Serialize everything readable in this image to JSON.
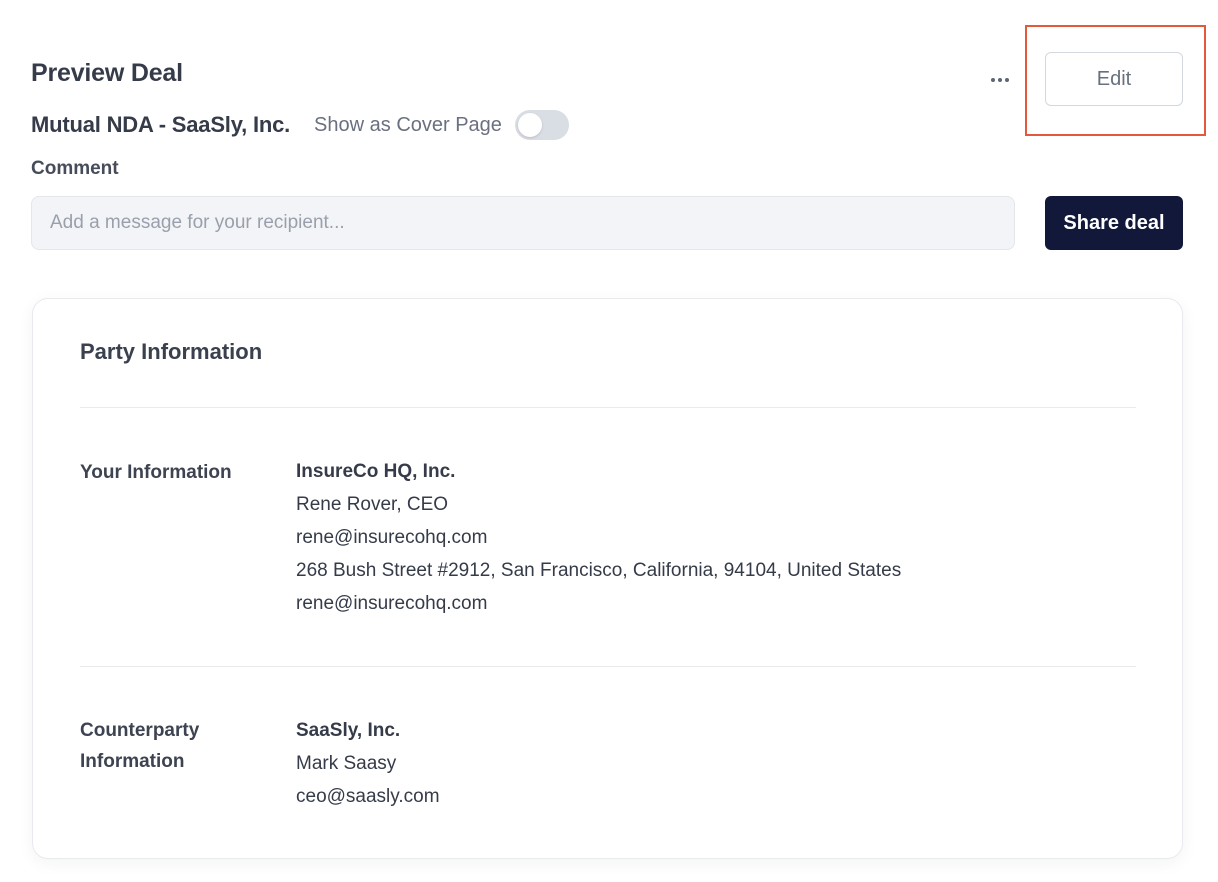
{
  "header": {
    "title": "Preview Deal",
    "edit_label": "Edit",
    "more_icon": "more-horizontal-icon"
  },
  "deal": {
    "name": "Mutual NDA - SaaSly, Inc.",
    "cover_page_label": "Show as Cover Page",
    "cover_page_enabled": false
  },
  "comment": {
    "label": "Comment",
    "placeholder": "Add a message for your recipient...",
    "value": ""
  },
  "share": {
    "label": "Share deal"
  },
  "party_info": {
    "title": "Party Information",
    "your_info": {
      "label": "Your Information",
      "company": "InsureCo HQ, Inc.",
      "contact": "Rene Rover, CEO",
      "email": "rene@insurecohq.com",
      "address": "268 Bush Street #2912, San Francisco, California, 94104, United States",
      "email_secondary": "rene@insurecohq.com"
    },
    "counterparty_info": {
      "label_line1": "Counterparty",
      "label_line2": "Information",
      "company": "SaaSly, Inc.",
      "contact": "Mark Saasy",
      "email": "ceo@saasly.com"
    }
  },
  "colors": {
    "primary_button": "#11183a",
    "highlight_border": "#e4583b",
    "input_background": "#f3f4f7",
    "text_primary": "#353b48"
  }
}
